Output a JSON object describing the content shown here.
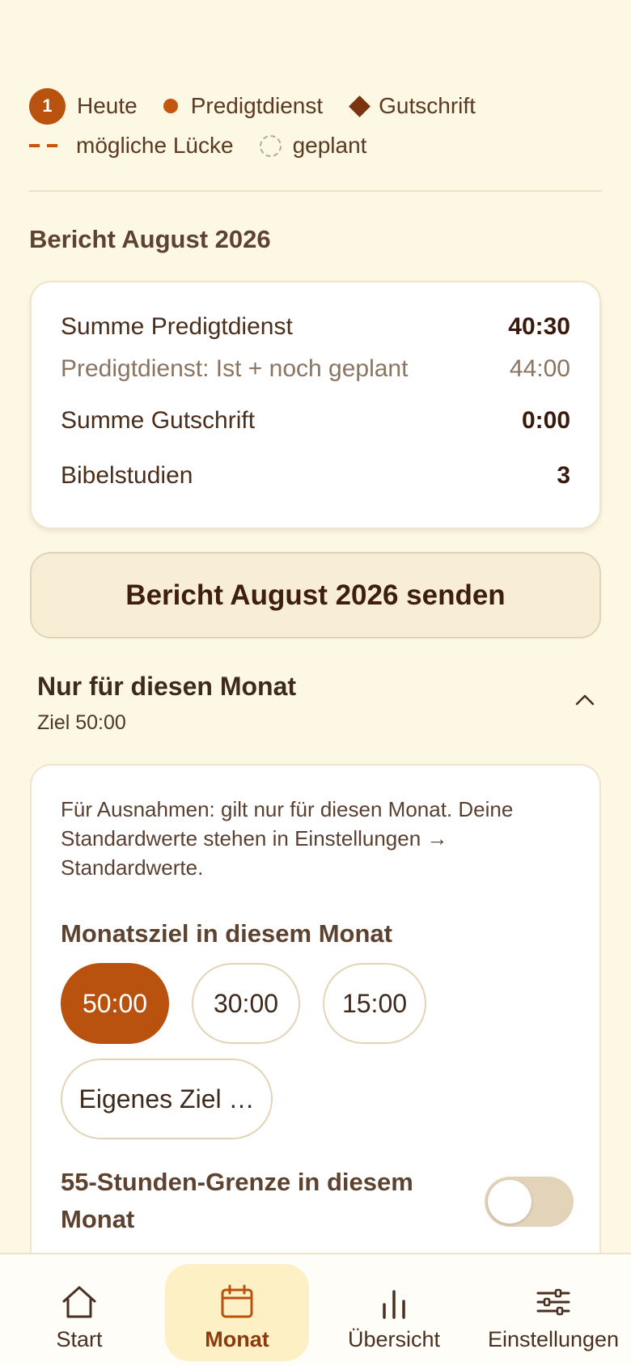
{
  "legend": {
    "today_num": "1",
    "today": "Heute",
    "service": "Predigtdienst",
    "credit": "Gutschrift",
    "gap": "mögliche Lücke",
    "planned": "geplant"
  },
  "report": {
    "title": "Bericht August 2026",
    "rows": [
      {
        "label": "Summe Predigtdienst",
        "value": "40:30"
      },
      {
        "label": "Predigtdienst: Ist + noch geplant",
        "value": "44:00"
      },
      {
        "label": "Summe Gutschrift",
        "value": "0:00"
      },
      {
        "label": "Bibelstudien",
        "value": "3"
      }
    ],
    "send_label": "Bericht August 2026 senden"
  },
  "month_section": {
    "title": "Nur für diesen Monat",
    "subtitle": "Ziel 50:00",
    "hint": "Für Ausnahmen: gilt nur für diesen Monat. Deine Standardwerte stehen in Einstellungen → Standardwerte.",
    "goal_label": "Monatsziel in diesem Monat",
    "goal_options": [
      "50:00",
      "30:00",
      "15:00"
    ],
    "selected_goal": "50:00",
    "custom_goal": "Eigenes Ziel …",
    "limit_label": "55-Stunden-Grenze in diesem Monat",
    "limit_enabled": false
  },
  "nav": {
    "items": [
      {
        "label": "Start",
        "icon": "home-icon"
      },
      {
        "label": "Monat",
        "icon": "calendar-icon"
      },
      {
        "label": "Übersicht",
        "icon": "bar-chart-icon"
      },
      {
        "label": "Einstellungen",
        "icon": "sliders-icon"
      }
    ],
    "active": "Monat"
  },
  "colors": {
    "accent": "#b9520e",
    "background": "#fdf8e4",
    "nav_active_bg": "#fdf0c4"
  }
}
